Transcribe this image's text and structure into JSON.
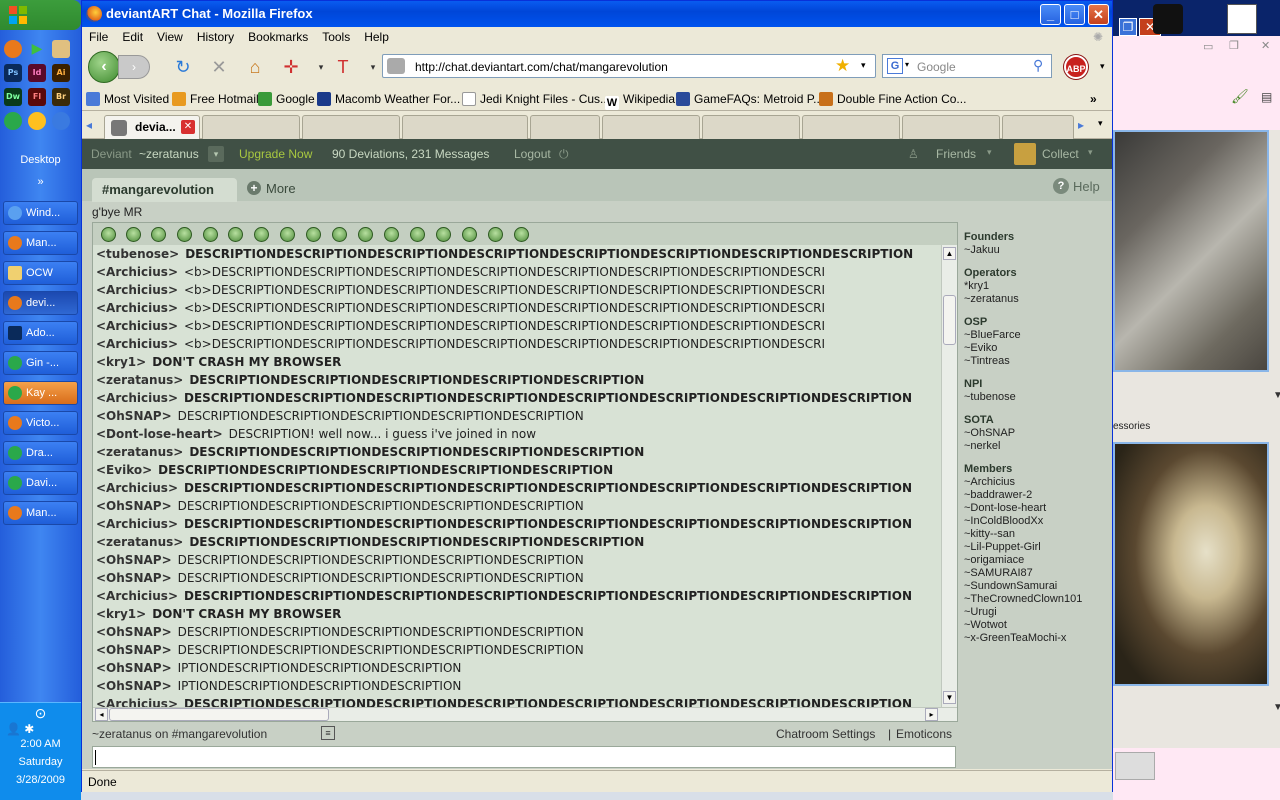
{
  "taskbar": {
    "desktop_label": "Desktop",
    "buttons": [
      {
        "label": "Wind...",
        "icon": "ie-icon"
      },
      {
        "label": "Man...",
        "icon": "firefox-icon"
      },
      {
        "label": "OCW",
        "icon": "folder-icon"
      },
      {
        "label": "devi...",
        "icon": "firefox-icon"
      },
      {
        "label": "Ado...",
        "icon": "photoshop-icon"
      },
      {
        "label": "Gin -...",
        "icon": "msn-icon"
      },
      {
        "label": "Kay ...",
        "icon": "msn-icon"
      },
      {
        "label": "Victo...",
        "icon": "firefox-icon"
      },
      {
        "label": "Dra...",
        "icon": "msn-icon"
      },
      {
        "label": "Davi...",
        "icon": "msn-icon"
      },
      {
        "label": "Man...",
        "icon": "firefox-icon"
      }
    ],
    "clock": {
      "time": "2:00 AM",
      "day": "Saturday",
      "date": "3/28/2009"
    },
    "quicklaunch": [
      "Ps",
      "Id",
      "Ai",
      "Dw",
      "Fl",
      "Br"
    ]
  },
  "window": {
    "title": "deviantART Chat - Mozilla Firefox",
    "menu": [
      "File",
      "Edit",
      "View",
      "History",
      "Bookmarks",
      "Tools",
      "Help"
    ],
    "url": "http://chat.deviantart.com/chat/mangarevolution",
    "search_placeholder": "Google",
    "abp_label": "ABP",
    "bookmarks": [
      "Most Visited",
      "Free Hotmail",
      "Google",
      "Macomb Weather For...",
      "Jedi Knight Files - Cus...",
      "Wikipedia",
      "GameFAQs: Metroid P...",
      "Double Fine Action Co..."
    ],
    "tab_label": "devia...",
    "status": "Done"
  },
  "da": {
    "deviant_prefix": "Deviant",
    "username": "~zeratanus",
    "upgrade": "Upgrade Now",
    "stats": "90 Deviations, 231 Messages",
    "logout": "Logout",
    "friends": "Friends",
    "collect": "Collect",
    "room": "#mangarevolution",
    "more": "More",
    "help": "Help",
    "topic": "g'bye MR",
    "chat_status": "~zeratanus on #mangarevolution",
    "settings": "Chatroom Settings",
    "separator": "|",
    "emoticons": "Emoticons"
  },
  "messages": [
    {
      "nick": "<tubenose>",
      "text": "DESCRIPTIONDESCRIPTIONDESCRIPTIONDESCRIPTIONDESCRIPTIONDESCRIPTIONDESCRIPTIONDESCRIPTION",
      "bold": true
    },
    {
      "nick": "<Archicius>",
      "text": "<b>DESCRIPTIONDESCRIPTIONDESCRIPTIONDESCRIPTIONDESCRIPTIONDESCRIPTIONDESCRIPTIONDESCRI",
      "bold": false
    },
    {
      "nick": "<Archicius>",
      "text": "<b>DESCRIPTIONDESCRIPTIONDESCRIPTIONDESCRIPTIONDESCRIPTIONDESCRIPTIONDESCRIPTIONDESCRI",
      "bold": false
    },
    {
      "nick": "<Archicius>",
      "text": "<b>DESCRIPTIONDESCRIPTIONDESCRIPTIONDESCRIPTIONDESCRIPTIONDESCRIPTIONDESCRIPTIONDESCRI",
      "bold": false
    },
    {
      "nick": "<Archicius>",
      "text": "<b>DESCRIPTIONDESCRIPTIONDESCRIPTIONDESCRIPTIONDESCRIPTIONDESCRIPTIONDESCRIPTIONDESCRI",
      "bold": false
    },
    {
      "nick": "<Archicius>",
      "text": "<b>DESCRIPTIONDESCRIPTIONDESCRIPTIONDESCRIPTIONDESCRIPTIONDESCRIPTIONDESCRIPTIONDESCRI",
      "bold": false
    },
    {
      "nick": "<kry1>",
      "text": "DON'T CRASH MY BROWSER",
      "bold": true
    },
    {
      "nick": "<zeratanus>",
      "text": "DESCRIPTIONDESCRIPTIONDESCRIPTIONDESCRIPTIONDESCRIPTION",
      "bold": true
    },
    {
      "nick": "<Archicius>",
      "text": "DESCRIPTIONDESCRIPTIONDESCRIPTIONDESCRIPTIONDESCRIPTIONDESCRIPTIONDESCRIPTIONDESCRIPTION",
      "bold": true
    },
    {
      "nick": "<OhSNAP>",
      "text": "DESCRIPTIONDESCRIPTIONDESCRIPTIONDESCRIPTIONDESCRIPTION",
      "bold": false
    },
    {
      "nick": "<Dont-lose-heart>",
      "text": "DESCRIPTION! well now... i guess i've joined in now",
      "bold": false
    },
    {
      "nick": "<zeratanus>",
      "text": "DESCRIPTIONDESCRIPTIONDESCRIPTIONDESCRIPTIONDESCRIPTION",
      "bold": true
    },
    {
      "nick": "<Eviko>",
      "text": "DESCRIPTIONDESCRIPTIONDESCRIPTIONDESCRIPTIONDESCRIPTION",
      "bold": true
    },
    {
      "nick": "<Archicius>",
      "text": "DESCRIPTIONDESCRIPTIONDESCRIPTIONDESCRIPTIONDESCRIPTIONDESCRIPTIONDESCRIPTIONDESCRIPTION",
      "bold": true
    },
    {
      "nick": "<OhSNAP>",
      "text": "DESCRIPTIONDESCRIPTIONDESCRIPTIONDESCRIPTIONDESCRIPTION",
      "bold": false
    },
    {
      "nick": "<Archicius>",
      "text": "DESCRIPTIONDESCRIPTIONDESCRIPTIONDESCRIPTIONDESCRIPTIONDESCRIPTIONDESCRIPTIONDESCRIPTION",
      "bold": true
    },
    {
      "nick": "<zeratanus>",
      "text": "DESCRIPTIONDESCRIPTIONDESCRIPTIONDESCRIPTIONDESCRIPTION",
      "bold": true
    },
    {
      "nick": "<OhSNAP>",
      "text": "DESCRIPTIONDESCRIPTIONDESCRIPTIONDESCRIPTIONDESCRIPTION",
      "bold": false
    },
    {
      "nick": "<OhSNAP>",
      "text": "DESCRIPTIONDESCRIPTIONDESCRIPTIONDESCRIPTIONDESCRIPTION",
      "bold": false
    },
    {
      "nick": "<Archicius>",
      "text": "DESCRIPTIONDESCRIPTIONDESCRIPTIONDESCRIPTIONDESCRIPTIONDESCRIPTIONDESCRIPTIONDESCRIPTION",
      "bold": true
    },
    {
      "nick": "<kry1>",
      "text": "DON'T CRASH MY BROWSER",
      "bold": true
    },
    {
      "nick": "<OhSNAP>",
      "text": "DESCRIPTIONDESCRIPTIONDESCRIPTIONDESCRIPTIONDESCRIPTION",
      "bold": false
    },
    {
      "nick": "<OhSNAP>",
      "text": "DESCRIPTIONDESCRIPTIONDESCRIPTIONDESCRIPTIONDESCRIPTION",
      "bold": false
    },
    {
      "nick": "<OhSNAP>",
      "text": "IPTIONDESCRIPTIONDESCRIPTIONDESCRIPTION",
      "bold": false
    },
    {
      "nick": "<OhSNAP>",
      "text": "IPTIONDESCRIPTIONDESCRIPTIONDESCRIPTION",
      "bold": false
    },
    {
      "nick": "<Archicius>",
      "text": "DESCRIPTIONDESCRIPTIONDESCRIPTIONDESCRIPTIONDESCRIPTIONDESCRIPTIONDESCRIPTIONDESCRIPTION",
      "bold": true
    }
  ],
  "member_groups": [
    {
      "title": "Founders",
      "members": [
        "~Jakuu"
      ]
    },
    {
      "title": "Operators",
      "members": [
        "*kry1",
        "~zeratanus"
      ]
    },
    {
      "title": "OSP",
      "members": [
        "~BlueFarce",
        "~Eviko",
        "~Tintreas"
      ]
    },
    {
      "title": "NPI",
      "members": [
        "~tubenose"
      ]
    },
    {
      "title": "SOTA",
      "members": [
        "~OhSNAP",
        "~nerkel"
      ]
    },
    {
      "title": "Members",
      "members": [
        "~Archicius",
        "~baddrawer-2",
        "~Dont-lose-heart",
        "~InColdBloodXx",
        "~kitty--san",
        "~Lil-Puppet-Girl",
        "~origamiace",
        "~SAMURAI87",
        "~SundownSamurai",
        "~TheCrownedClown101",
        "~Urugi",
        "~Wotwot",
        "~x-GreenTeaMochi-x"
      ]
    }
  ],
  "right_panel": {
    "label": "essories"
  }
}
